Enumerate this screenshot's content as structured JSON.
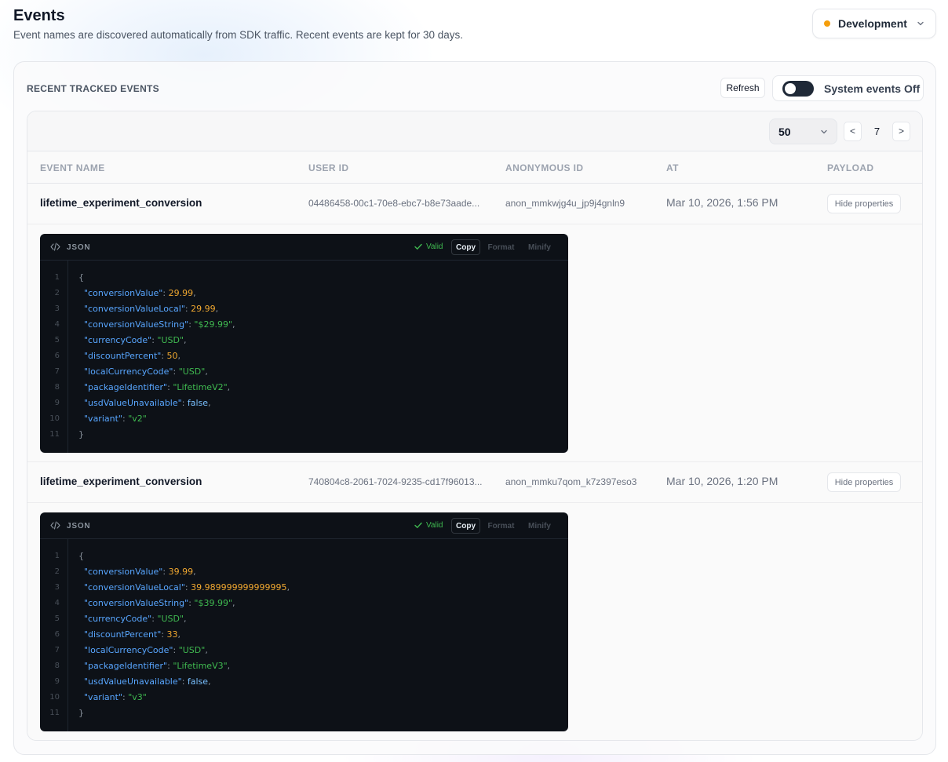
{
  "header": {
    "title": "Events",
    "subtitle": "Event names are discovered automatically from SDK traffic. Recent events are kept for 30 days.",
    "environment": "Development",
    "environment_color": "#f59e0b"
  },
  "section": {
    "title": "RECENT TRACKED EVENTS",
    "refresh_label": "Refresh",
    "system_events_label": "System events Off",
    "system_events_enabled": false
  },
  "pagination": {
    "page_size": "50",
    "prev_label": "<",
    "page": "7",
    "next_label": ">"
  },
  "columns": [
    "EVENT NAME",
    "USER ID",
    "ANONYMOUS ID",
    "AT",
    "PAYLOAD"
  ],
  "json_panel": {
    "title": "JSON",
    "valid_label": "Valid",
    "copy_label": "Copy",
    "format_label": "Format",
    "minify_label": "Minify"
  },
  "events": [
    {
      "name": "lifetime_experiment_conversion",
      "user_id": "04486458-00c1-70e8-ebc7-b8e73aade...",
      "anonymous_id": "anon_mmkwjg4u_jp9j4gnln9",
      "at": "Mar 10, 2026, 1:56 PM",
      "action_label": "Hide properties",
      "payload": [
        {
          "key": "conversionValue",
          "value": "29.99",
          "type": "n"
        },
        {
          "key": "conversionValueLocal",
          "value": "29.99",
          "type": "n"
        },
        {
          "key": "conversionValueString",
          "value": "\"$29.99\"",
          "type": "s"
        },
        {
          "key": "currencyCode",
          "value": "\"USD\"",
          "type": "s"
        },
        {
          "key": "discountPercent",
          "value": "50",
          "type": "n"
        },
        {
          "key": "localCurrencyCode",
          "value": "\"USD\"",
          "type": "s"
        },
        {
          "key": "packageIdentifier",
          "value": "\"LifetimeV2\"",
          "type": "s"
        },
        {
          "key": "usdValueUnavailable",
          "value": "false",
          "type": "b"
        },
        {
          "key": "variant",
          "value": "\"v2\"",
          "type": "s"
        }
      ]
    },
    {
      "name": "lifetime_experiment_conversion",
      "user_id": "740804c8-2061-7024-9235-cd17f96013...",
      "anonymous_id": "anon_mmku7qom_k7z397eso3",
      "at": "Mar 10, 2026, 1:20 PM",
      "action_label": "Hide properties",
      "payload": [
        {
          "key": "conversionValue",
          "value": "39.99",
          "type": "n"
        },
        {
          "key": "conversionValueLocal",
          "value": "39.989999999999995",
          "type": "n"
        },
        {
          "key": "conversionValueString",
          "value": "\"$39.99\"",
          "type": "s"
        },
        {
          "key": "currencyCode",
          "value": "\"USD\"",
          "type": "s"
        },
        {
          "key": "discountPercent",
          "value": "33",
          "type": "n"
        },
        {
          "key": "localCurrencyCode",
          "value": "\"USD\"",
          "type": "s"
        },
        {
          "key": "packageIdentifier",
          "value": "\"LifetimeV3\"",
          "type": "s"
        },
        {
          "key": "usdValueUnavailable",
          "value": "false",
          "type": "b"
        },
        {
          "key": "variant",
          "value": "\"v3\"",
          "type": "s"
        }
      ]
    }
  ]
}
